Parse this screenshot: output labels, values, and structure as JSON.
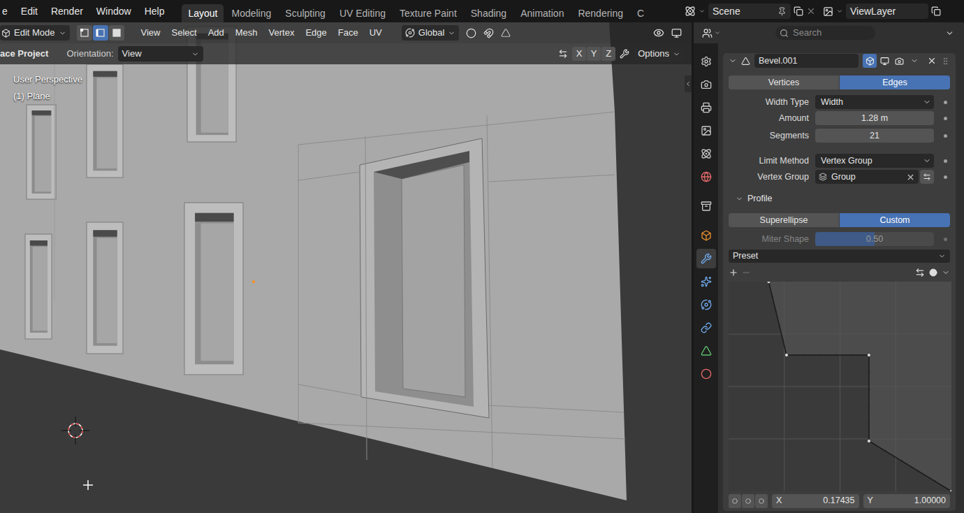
{
  "topbar": {
    "menus": [
      "e",
      "Edit",
      "Render",
      "Window",
      "Help"
    ],
    "workspaces": [
      {
        "label": "Layout",
        "selected": true
      },
      {
        "label": "Modeling",
        "selected": false
      },
      {
        "label": "Sculpting",
        "selected": false
      },
      {
        "label": "UV Editing",
        "selected": false
      },
      {
        "label": "Texture Paint",
        "selected": false
      },
      {
        "label": "Shading",
        "selected": false
      },
      {
        "label": "Animation",
        "selected": false
      },
      {
        "label": "Rendering",
        "selected": false
      },
      {
        "label": "C",
        "selected": false
      }
    ],
    "scene": "Scene",
    "view_layer": "ViewLayer"
  },
  "viewport_header": {
    "mode": "Edit Mode",
    "select_modes": [
      {
        "selected": false
      },
      {
        "selected": true
      },
      {
        "selected": false
      }
    ],
    "menus": [
      "View",
      "Select",
      "Add",
      "Mesh",
      "Vertex",
      "Edge",
      "Face",
      "UV"
    ],
    "orientation": "Global"
  },
  "tool_settings": {
    "tool": "ace Project",
    "orientation_label": "Orientation:",
    "orientation": "View",
    "axes": [
      {
        "label": "X",
        "selected": false
      },
      {
        "label": "Y",
        "selected": false
      },
      {
        "label": "Z",
        "selected": false
      }
    ],
    "options": "Options"
  },
  "viewport": {
    "view_name": "User Perspective",
    "object": "(1) Plane"
  },
  "properties": {
    "search_placeholder": "Search",
    "tabs": [
      {
        "selected": false
      },
      {
        "selected": false
      },
      {
        "selected": false
      },
      {
        "selected": false
      },
      {
        "selected": false
      },
      {
        "selected": false
      },
      {
        "selected": false
      },
      {
        "selected": false
      },
      {
        "selected": true
      },
      {
        "selected": false
      },
      {
        "selected": false
      },
      {
        "selected": false
      },
      {
        "selected": false
      },
      {
        "selected": false
      }
    ],
    "modifier": {
      "name": "Bevel.001",
      "expanded": true,
      "toggles": [
        {
          "selected": true
        },
        {
          "selected": false
        },
        {
          "selected": false
        }
      ],
      "affect": [
        {
          "label": "Vertices",
          "selected": false
        },
        {
          "label": "Edges",
          "selected": true
        }
      ],
      "fields": [
        {
          "label": "Width Type",
          "value": "Width",
          "kind": "dropdown"
        },
        {
          "label": "Amount",
          "value": "1.28 m",
          "kind": "number"
        },
        {
          "label": "Segments",
          "value": "21",
          "kind": "number"
        },
        {
          "label": "Limit Method",
          "value": "Vertex Group",
          "kind": "dropdown"
        },
        {
          "label": "Vertex Group",
          "value": "Group",
          "kind": "search"
        }
      ],
      "profile": {
        "title": "Profile",
        "expanded": true,
        "types": [
          {
            "label": "Superellipse",
            "selected": false
          },
          {
            "label": "Custom",
            "selected": true
          }
        ],
        "miter": {
          "label": "Miter Shape",
          "value": "0.50",
          "level": 0.5,
          "disabled": true
        },
        "preset": "Preset",
        "curve": {
          "points": [
            [
              0.18,
              1.0
            ],
            [
              0.26,
              0.65
            ],
            [
              0.63,
              0.65
            ],
            [
              0.63,
              0.24
            ],
            [
              1.0,
              0.0
            ]
          ]
        },
        "coords": [
          {
            "label": "X",
            "value": "0.17435"
          },
          {
            "label": "Y",
            "value": "1.00000"
          }
        ]
      }
    }
  }
}
